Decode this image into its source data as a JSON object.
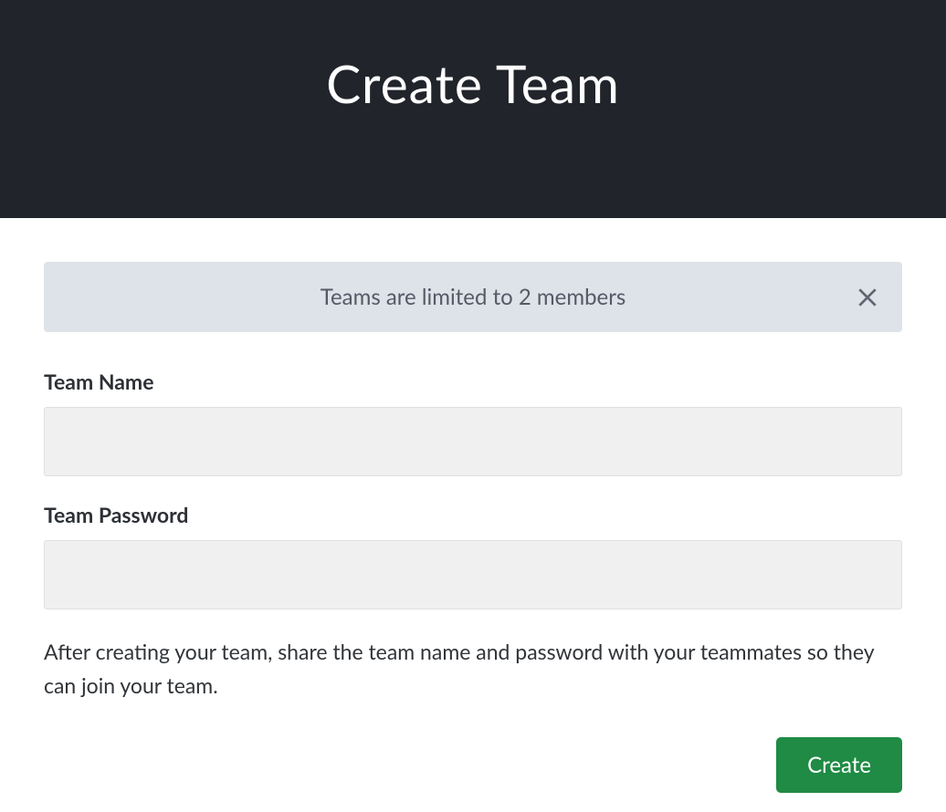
{
  "header": {
    "title": "Create Team"
  },
  "alert": {
    "message": "Teams are limited to 2 members"
  },
  "form": {
    "team_name": {
      "label": "Team Name",
      "value": ""
    },
    "team_password": {
      "label": "Team Password",
      "value": ""
    },
    "help_text": "After creating your team, share the team name and password with your teammates so they can join your team.",
    "submit_label": "Create"
  }
}
